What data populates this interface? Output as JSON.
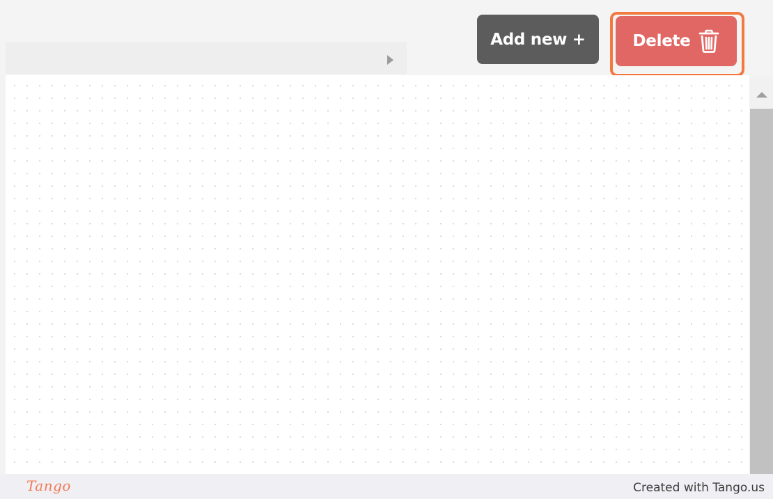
{
  "toolbar": {
    "add_label": "Add new +",
    "delete_label": "Delete"
  },
  "footer": {
    "logo": "Tango",
    "credit": "Created with Tango.us"
  },
  "colors": {
    "add_button": "#5c5c5c",
    "delete_button": "#e06764",
    "highlight": "#f2793f",
    "logo": "#f07b57"
  },
  "icons": {
    "tab_scroll": "caret-right-icon",
    "delete": "trash-icon",
    "scroll_up": "caret-up-icon"
  }
}
